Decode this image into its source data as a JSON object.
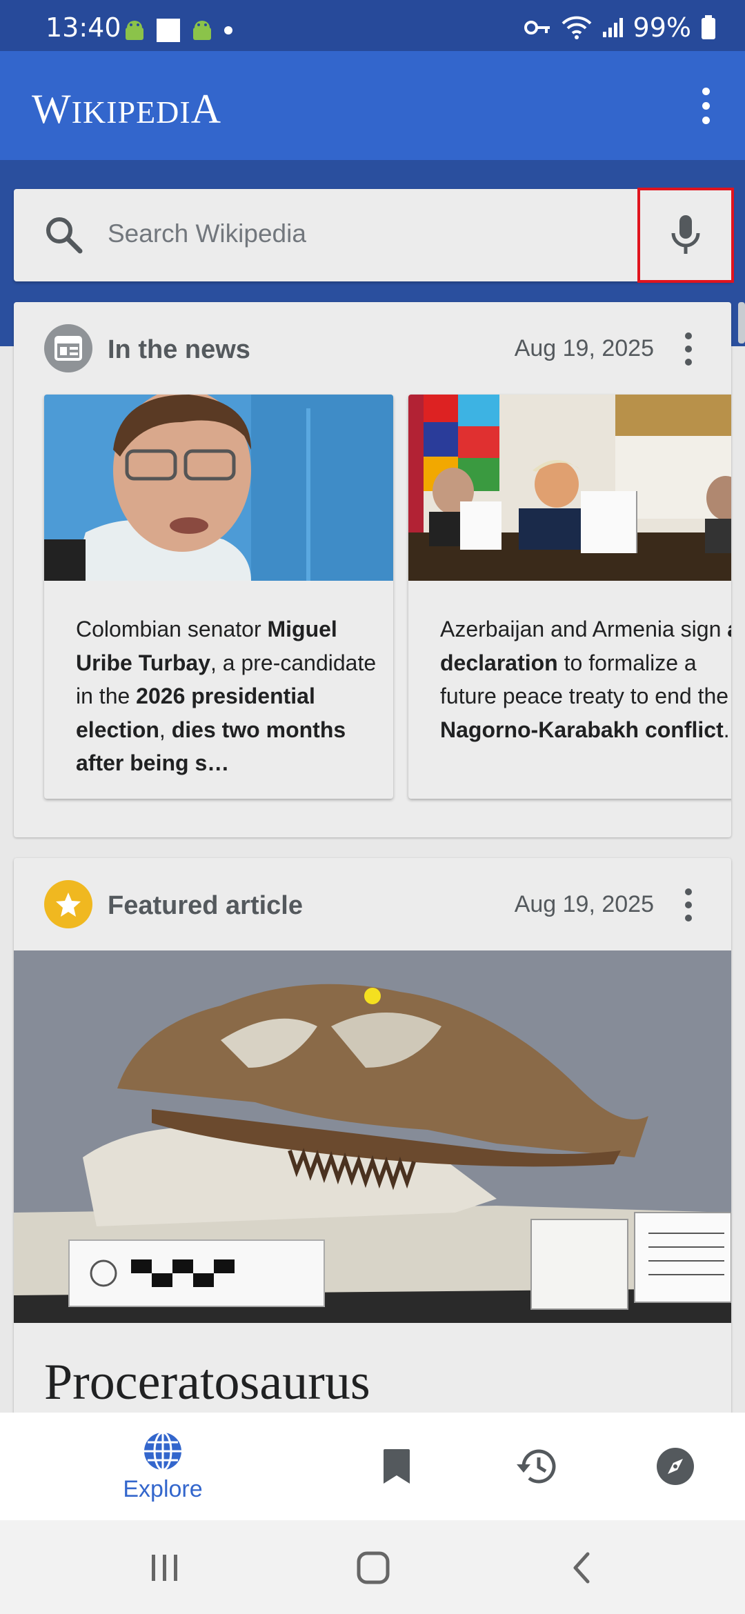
{
  "status_bar": {
    "time": "13:40",
    "battery": "99%",
    "left_icons": [
      "android-icon",
      "image-icon",
      "android-icon",
      "dot-icon"
    ],
    "right_icons": [
      "key-icon",
      "wifi-icon",
      "signal-icon",
      "battery-icon"
    ]
  },
  "app_bar": {
    "logo_first": "W",
    "logo_mid": "IKIPEDI",
    "logo_last": "A",
    "menu_icon": "more-vert-icon"
  },
  "search": {
    "placeholder": "Search Wikipedia",
    "icon": "search-icon",
    "mic_icon": "mic-icon",
    "mic_highlight_color": "#e0141e"
  },
  "news_card": {
    "title": "In the news",
    "date": "Aug 19, 2025",
    "icon": "news-icon",
    "items": [
      {
        "text_parts": [
          {
            "t": "Colombian senator ",
            "bold": false
          },
          {
            "t": "Miguel Uribe Turbay",
            "bold": true
          },
          {
            "t": ", a pre-candidate in the ",
            "bold": false
          },
          {
            "t": "2026 presidential election",
            "bold": true
          },
          {
            "t": ", ",
            "bold": false
          },
          {
            "t": "dies two months after being s…",
            "bold": true
          }
        ]
      },
      {
        "text_parts": [
          {
            "t": "Azerbaijan and Armenia sign ",
            "bold": false
          },
          {
            "t": "a declaration",
            "bold": true
          },
          {
            "t": " to formalize a future peace treaty to end the ",
            "bold": false
          },
          {
            "t": "Nagorno-Karabakh conflict",
            "bold": true
          },
          {
            "t": ".",
            "bold": false
          }
        ]
      }
    ]
  },
  "featured_card": {
    "title": "Featured article",
    "date": "Aug 19, 2025",
    "icon": "star-icon",
    "article_title": "Proceratosaurus"
  },
  "bottom_nav": {
    "items": [
      {
        "label": "Explore",
        "icon": "globe-icon",
        "active": true
      },
      {
        "label": "",
        "icon": "bookmark-icon",
        "active": false
      },
      {
        "label": "",
        "icon": "history-icon",
        "active": false
      },
      {
        "label": "",
        "icon": "compass-icon",
        "active": false
      }
    ]
  },
  "colors": {
    "app_bar": "#3366cc",
    "status_bar": "#274a9a",
    "accent": "#3366cc",
    "featured_star": "#f0b820"
  }
}
